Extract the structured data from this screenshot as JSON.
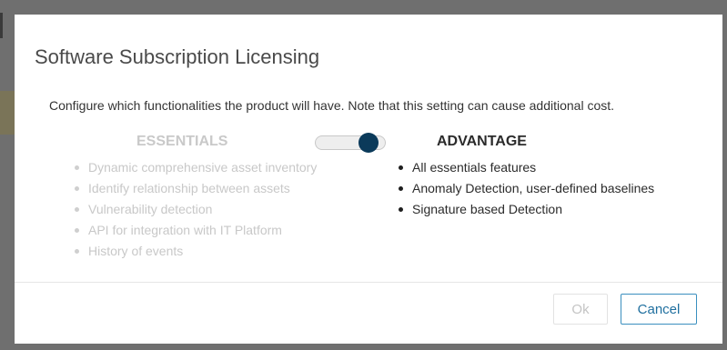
{
  "dialog": {
    "title": "Software Subscription Licensing",
    "description": "Configure which functionalities the product will have. Note that this setting can cause additional cost."
  },
  "plans": {
    "essentials": {
      "heading": "ESSENTIALS",
      "selected": false,
      "features": [
        "Dynamic comprehensive asset inventory",
        "Identify relationship between assets",
        "Vulnerability detection",
        "API for integration with IT Platform",
        "History of events"
      ]
    },
    "advantage": {
      "heading": "ADVANTAGE",
      "selected": true,
      "features": [
        "All essentials features",
        "Anomaly Detection, user-defined baselines",
        "Signature based Detection"
      ]
    }
  },
  "toggle": {
    "position": "advantage",
    "knob_color": "#0b3a5a"
  },
  "buttons": {
    "ok_label": "Ok",
    "ok_enabled": false,
    "cancel_label": "Cancel"
  },
  "colors": {
    "accent": "#3a8fbf",
    "disabled_text": "#c8c8c8"
  }
}
